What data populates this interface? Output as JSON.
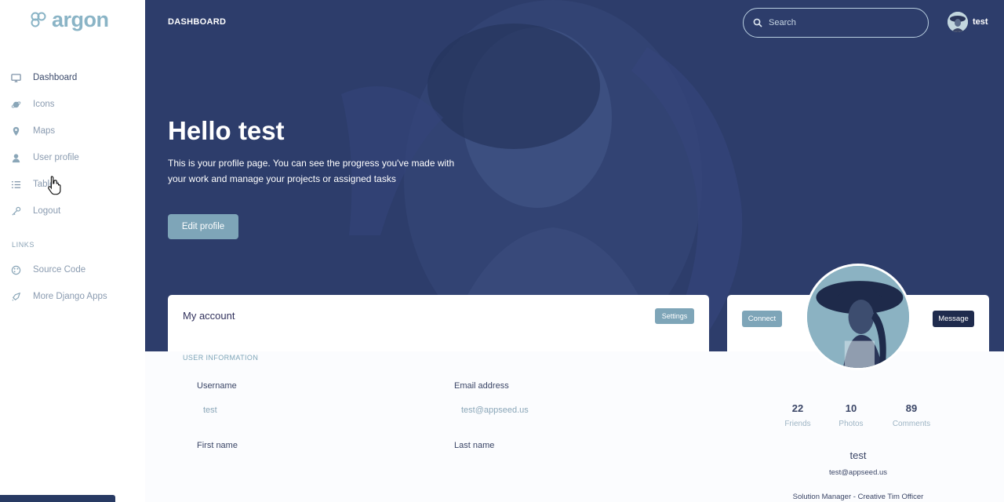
{
  "sidebar": {
    "brand": "argon",
    "items": [
      {
        "label": "Dashboard",
        "icon": "monitor-icon"
      },
      {
        "label": "Icons",
        "icon": "planet-icon"
      },
      {
        "label": "Maps",
        "icon": "map-pin-icon"
      },
      {
        "label": "User profile",
        "icon": "user-icon"
      },
      {
        "label": "Tables",
        "icon": "list-icon"
      },
      {
        "label": "Logout",
        "icon": "key-icon"
      }
    ],
    "links_heading": "LINKS",
    "links": [
      {
        "label": "Source Code",
        "icon": "palette-icon"
      },
      {
        "label": "More Django Apps",
        "icon": "spaceship-icon"
      }
    ]
  },
  "topbar": {
    "title": "DASHBOARD",
    "search_placeholder": "Search",
    "user_name": "test"
  },
  "hero": {
    "greeting": "Hello test",
    "text": "This is your profile page. You can see the progress you've made with your work and manage your projects or assigned tasks",
    "edit_button": "Edit profile"
  },
  "account": {
    "title": "My account",
    "settings_button": "Settings",
    "section_heading": "USER INFORMATION",
    "fields": {
      "username_label": "Username",
      "username_value": "test",
      "email_label": "Email address",
      "email_value": "test@appseed.us",
      "first_name_label": "First name",
      "last_name_label": "Last name"
    }
  },
  "profile": {
    "connect_button": "Connect",
    "message_button": "Message",
    "stats": [
      {
        "value": "22",
        "label": "Friends"
      },
      {
        "value": "10",
        "label": "Photos"
      },
      {
        "value": "89",
        "label": "Comments"
      }
    ],
    "name": "test",
    "email": "test@appseed.us",
    "job": "Solution Manager - Creative Tim Officer"
  },
  "colors": {
    "sidebar_bg": "#ffffff",
    "hero_bg": "#2c3c69",
    "accent": "#7ea5b8",
    "dark_button": "#1f2b4d"
  }
}
